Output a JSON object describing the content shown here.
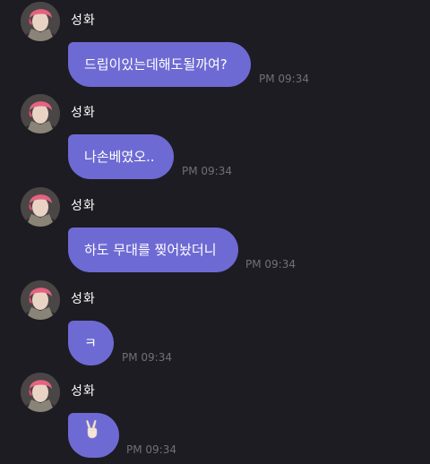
{
  "messages": [
    {
      "sender": "성화",
      "text": "드립이있는데해도될까여?",
      "time": "PM 09:34"
    },
    {
      "sender": "성화",
      "text": "나손베였오..",
      "time": "PM 09:34"
    },
    {
      "sender": "성화",
      "text": "하도 무대를 찢어놨더니",
      "time": "PM 09:34"
    },
    {
      "sender": "성화",
      "text": "ㅋ",
      "time": "PM 09:34"
    },
    {
      "sender": "성화",
      "emoji": "victory-hand-icon",
      "time": "PM 09:34"
    }
  ],
  "colors": {
    "background": "#1d1c22",
    "bubble": "#6e6ad4",
    "timestamp": "#707075",
    "name": "#ffffff"
  }
}
